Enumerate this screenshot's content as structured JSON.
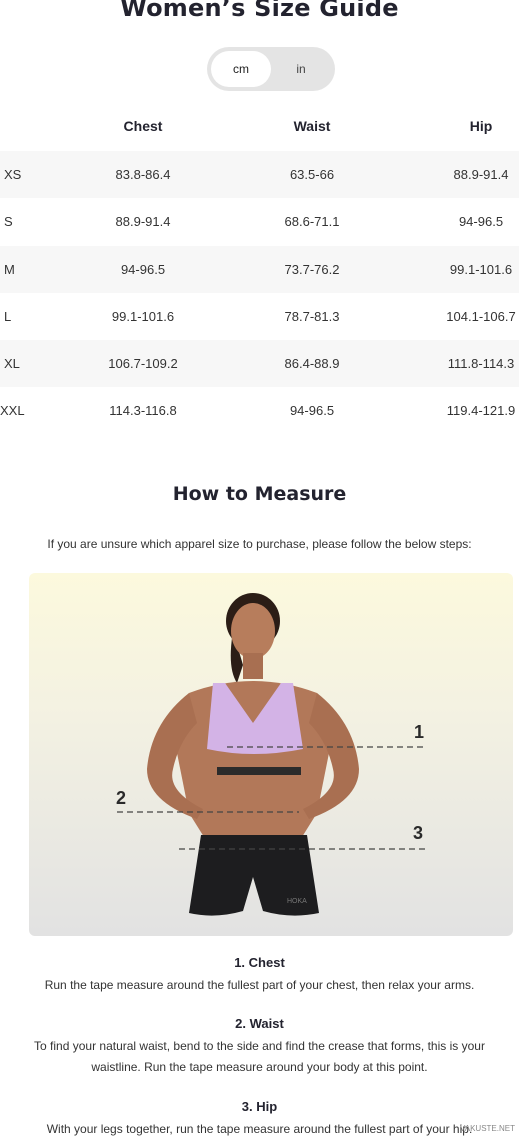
{
  "page": {
    "title": "Women’s Size Guide"
  },
  "units": {
    "options": [
      "cm",
      "in"
    ],
    "selected": "cm"
  },
  "table": {
    "headers": [
      "Chest",
      "Waist",
      "Hip"
    ],
    "rows": [
      {
        "size": "XS",
        "chest": "83.8-86.4",
        "waist": "63.5-66",
        "hip": "88.9-91.4"
      },
      {
        "size": "S",
        "chest": "88.9-91.4",
        "waist": "68.6-71.1",
        "hip": "94-96.5"
      },
      {
        "size": "M",
        "chest": "94-96.5",
        "waist": "73.7-76.2",
        "hip": "99.1-101.6"
      },
      {
        "size": "L",
        "chest": "99.1-101.6",
        "waist": "78.7-81.3",
        "hip": "104.1-106.7"
      },
      {
        "size": "XL",
        "chest": "106.7-109.2",
        "waist": "86.4-88.9",
        "hip": "111.8-114.3"
      },
      {
        "size": "XXL",
        "chest": "114.3-116.8",
        "waist": "94-96.5",
        "hip": "119.4-121.9"
      }
    ]
  },
  "measure": {
    "heading": "How to Measure",
    "intro": "If you are unsure which apparel size to purchase, please follow the below steps:",
    "figure_markers": [
      "1",
      "2",
      "3"
    ],
    "figure_logo": "HOKA",
    "steps": [
      {
        "title": "1. Chest",
        "text": "Run the tape measure around the fullest part of your chest, then relax your arms."
      },
      {
        "title": "2. Waist",
        "text": "To find your natural waist, bend to the side and find the crease that forms, this is your waistline. Run the tape measure around your body at this point."
      },
      {
        "title": "3. Hip",
        "text": "With your legs together, run the tape measure around the fullest part of your hip."
      }
    ]
  },
  "watermark": "VAKUSTE.NET",
  "colors": {
    "accent_dark": "#23232f",
    "toggle_bg": "#e4e4e4",
    "row_shade": "#f7f7f7",
    "bra": "#d3b3e6"
  }
}
